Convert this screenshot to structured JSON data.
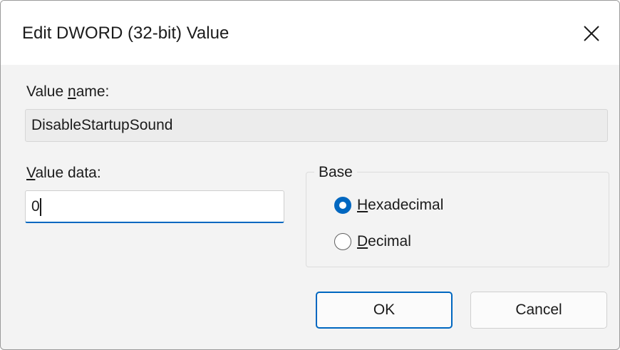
{
  "window": {
    "title": "Edit DWORD (32-bit) Value",
    "close_icon": "close-icon"
  },
  "value_name": {
    "label_pre": "Value ",
    "label_mnemonic": "n",
    "label_post": "ame:",
    "value": "DisableStartupSound"
  },
  "value_data": {
    "label_mnemonic": "V",
    "label_post": "alue data:",
    "value": "0"
  },
  "base": {
    "legend": "Base",
    "options": [
      {
        "mnemonic": "H",
        "rest": "exadecimal",
        "checked": true
      },
      {
        "mnemonic": "D",
        "rest": "ecimal",
        "checked": false
      }
    ]
  },
  "buttons": {
    "ok": "OK",
    "cancel": "Cancel"
  },
  "colors": {
    "accent": "#0067c0",
    "dialog_bg": "#f3f3f3"
  }
}
